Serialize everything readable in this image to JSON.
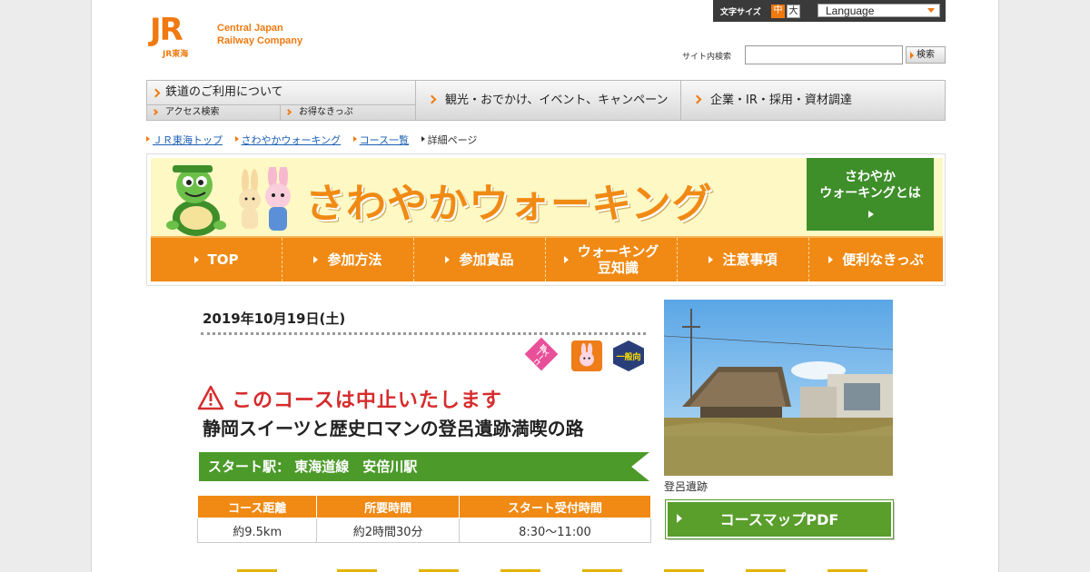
{
  "header": {
    "logo_mark": "JR",
    "logo_sub": "JR東海",
    "logo_name_line1": "Central Japan",
    "logo_name_line2": "Railway Company",
    "font_size_label": "文字サイズ",
    "font_size_medium": "中",
    "font_size_large": "大",
    "language_label": "Language",
    "search_label": "サイト内検索",
    "search_value": "",
    "search_button": "検索"
  },
  "global_nav": {
    "main_label": "鉄道のご利用について",
    "sub1_label": "アクセス検索",
    "sub2_label": "お得なきっぷ",
    "big1_label": "観光・おでかけ、イベント、キャンペーン",
    "big2_label": "企業・IR・採用・資材調達"
  },
  "breadcrumb": {
    "items": [
      "ＪＲ東海トップ",
      "さわやかウォーキング",
      "コース一覧"
    ],
    "current": "詳細ページ"
  },
  "banner": {
    "title": "さわやかウォーキング",
    "about_line1": "さわやか",
    "about_line2": "ウォーキングとは",
    "nav": [
      "TOP",
      "参加方法",
      "参加賞品",
      "ウォーキング",
      "豆知識",
      "注意事項",
      "便利なきっぷ"
    ]
  },
  "event": {
    "date": "2019年10月19日(土)",
    "badges": {
      "diamond_line1": "一部",
      "diamond_line2": "コース",
      "hex": "一般向"
    },
    "cancel_notice": "このコースは中止いたします",
    "title": "静岡スイーツと歴史ロマンの登呂遺跡満喫の路",
    "start_station": "スタート駅：  東海道線　安倍川駅",
    "table": {
      "headers": [
        "コース距離",
        "所要時間",
        "スタート受付時間"
      ],
      "values": [
        "約9.5km",
        "約2時間30分",
        "8:30～11:00"
      ]
    },
    "photo_caption": "登呂遺跡",
    "pdf_button": "コースマップPDF"
  },
  "colors": {
    "brand_orange": "#f08a14",
    "green": "#4c9a2a",
    "cancel_red": "#d62c2c"
  }
}
